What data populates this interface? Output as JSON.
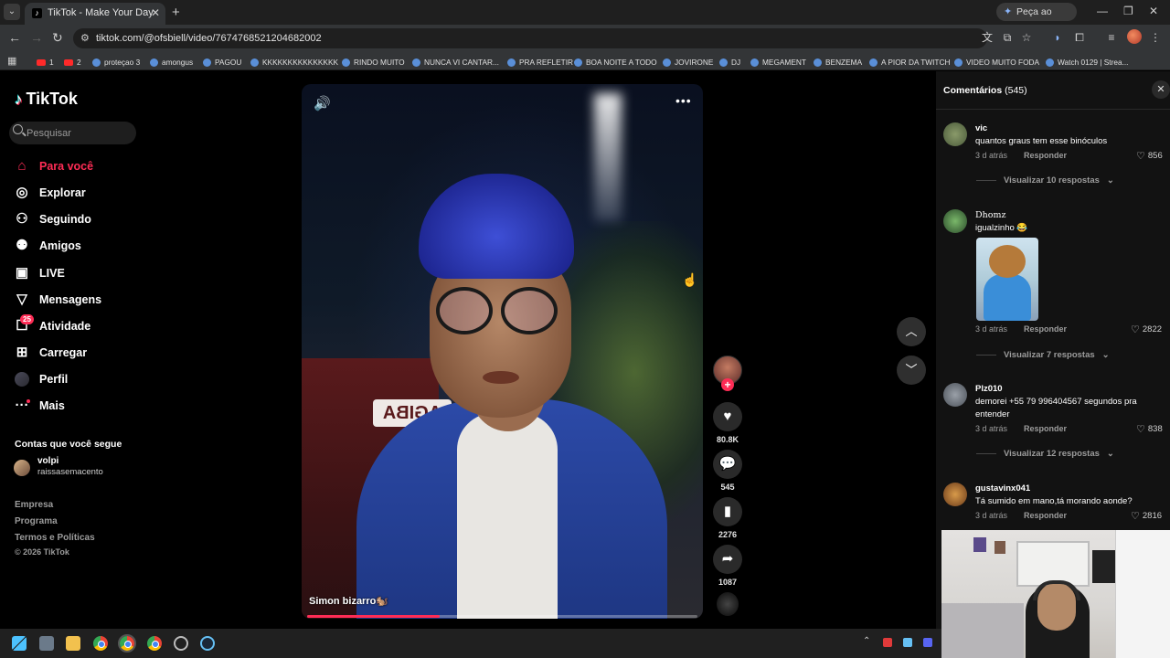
{
  "browser": {
    "tab_title": "TikTok - Make Your Day",
    "gemini_label": "Peça ao Gemini",
    "url": "tiktok.com/@ofsbiell/video/7674768521204682002"
  },
  "bookmarks": [
    "1",
    "2",
    "proteçao 3",
    "amongus",
    "PAGOU",
    "KKKKKKKKKKKKKKK",
    "RINDO MUITO",
    "NUNCA VI CANTAR...",
    "PRA REFLETIR",
    "BOA NOITE A TODO",
    "JOVIRONE",
    "DJ",
    "MEGAMENT",
    "BENZEMA",
    "A PIOR DA TWITCH",
    "VIDEO MUITO FODA",
    "Watch 0129 | Strea..."
  ],
  "sidebar": {
    "logo": "TikTok",
    "search_placeholder": "Pesquisar",
    "nav": [
      {
        "label": "Para você",
        "icon": "home-icon"
      },
      {
        "label": "Explorar",
        "icon": "compass-icon"
      },
      {
        "label": "Seguindo",
        "icon": "user-follow-icon"
      },
      {
        "label": "Amigos",
        "icon": "friends-icon"
      },
      {
        "label": "LIVE",
        "icon": "live-icon"
      },
      {
        "label": "Mensagens",
        "icon": "message-icon"
      },
      {
        "label": "Atividade",
        "icon": "activity-icon"
      },
      {
        "label": "Carregar",
        "icon": "upload-icon"
      },
      {
        "label": "Perfil",
        "icon": "avatar"
      },
      {
        "label": "Mais",
        "icon": "more-icon"
      }
    ],
    "activity_badge": "25",
    "following_title": "Contas que você segue",
    "following": {
      "name": "volpi",
      "handle": "raissasemacento"
    },
    "footer": [
      "Empresa",
      "Programa",
      "Termos e Políticas",
      "© 2026 TikTok"
    ]
  },
  "video": {
    "caption": "Simon bizarro🐿️",
    "sign_text": "AGIBA",
    "progress": 0.34
  },
  "actions": {
    "likes": "80.8K",
    "comments": "545",
    "saves": "2276",
    "shares": "1087"
  },
  "comments_panel": {
    "title": "Comentários",
    "count": "(545)",
    "reply_label": "Responder",
    "items": [
      {
        "user": "vic",
        "text": "quantos graus tem esse binóculos",
        "time": "3 d atrás",
        "likes": "856",
        "view_replies": "Visualizar 10 respostas"
      },
      {
        "user": "Dhomz",
        "text": "igualzinho 😂",
        "time": "3 d atrás",
        "likes": "2822",
        "view_replies": "Visualizar 7 respostas"
      },
      {
        "user": "Plz010",
        "text": "demorei +55 79 996404567 segundos pra entender",
        "time": "3 d atrás",
        "likes": "838",
        "view_replies": "Visualizar 12 respostas"
      },
      {
        "user": "gustavinx041",
        "text": "Tá sumido em mano,tá morando aonde?",
        "time": "3 d atrás",
        "likes": "2816"
      }
    ]
  },
  "colors": {
    "accent": "#fe2c55",
    "panel_bg": "#121212"
  }
}
